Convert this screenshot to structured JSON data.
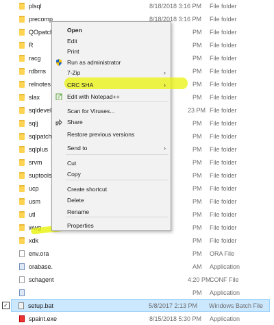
{
  "files": [
    {
      "name": "plsql",
      "date": "8/18/2018 3:16 PM",
      "type": "File folder",
      "icon": "folder"
    },
    {
      "name": "precomp",
      "date": "8/18/2018 3:16 PM",
      "type": "File folder",
      "icon": "folder"
    },
    {
      "name": "QOpatch",
      "date": "PM",
      "type": "File folder",
      "icon": "folder"
    },
    {
      "name": "R",
      "date": "PM",
      "type": "File folder",
      "icon": "folder"
    },
    {
      "name": "racg",
      "date": "PM",
      "type": "File folder",
      "icon": "folder"
    },
    {
      "name": "rdbms",
      "date": "PM",
      "type": "File folder",
      "icon": "folder"
    },
    {
      "name": "relnotes",
      "date": "PM",
      "type": "File folder",
      "icon": "folder"
    },
    {
      "name": "slax",
      "date": "PM",
      "type": "File folder",
      "icon": "folder"
    },
    {
      "name": "sqldevelo",
      "date": "23 PM",
      "type": "File folder",
      "icon": "folder"
    },
    {
      "name": "sqlj",
      "date": "PM",
      "type": "File folder",
      "icon": "folder"
    },
    {
      "name": "sqlpatch",
      "date": "PM",
      "type": "File folder",
      "icon": "folder"
    },
    {
      "name": "sqlplus",
      "date": "PM",
      "type": "File folder",
      "icon": "folder"
    },
    {
      "name": "srvm",
      "date": "PM",
      "type": "File folder",
      "icon": "folder"
    },
    {
      "name": "suptools",
      "date": "PM",
      "type": "File folder",
      "icon": "folder"
    },
    {
      "name": "ucp",
      "date": "PM",
      "type": "File folder",
      "icon": "folder"
    },
    {
      "name": "usm",
      "date": "PM",
      "type": "File folder",
      "icon": "folder"
    },
    {
      "name": "utl",
      "date": "PM",
      "type": "File folder",
      "icon": "folder"
    },
    {
      "name": "wwg",
      "date": "PM",
      "type": "File folder",
      "icon": "folder"
    },
    {
      "name": "xdk",
      "date": "PM",
      "type": "File folder",
      "icon": "folder"
    },
    {
      "name": "env.ora",
      "date": "PM",
      "type": "ORA File",
      "icon": "file"
    },
    {
      "name": "orabase.",
      "date": "AM",
      "type": "Application",
      "icon": "app"
    },
    {
      "name": "schagent",
      "date": "4:20 PM",
      "type": "CONF File",
      "icon": "file"
    },
    {
      "name": "",
      "date": "PM",
      "type": "Application",
      "icon": "app"
    },
    {
      "name": "setup.bat",
      "date": "5/8/2017 2:13 PM",
      "type": "Windows Batch File",
      "icon": "bat",
      "selected": true
    },
    {
      "name": "spaint.exe",
      "date": "8/15/2018 5:30 PM",
      "type": "Application",
      "icon": "red"
    }
  ],
  "menu": {
    "items": [
      {
        "label": "Open",
        "bold": true,
        "icon": ""
      },
      {
        "label": "Edit",
        "icon": ""
      },
      {
        "label": "Print",
        "icon": ""
      },
      {
        "label": "Run as administrator",
        "icon": "shield"
      },
      {
        "label": "7-Zip",
        "icon": "",
        "submenu": true
      },
      {
        "label": "CRC SHA",
        "icon": "",
        "submenu": true
      },
      {
        "label": "Edit with Notepad++",
        "icon": "notepad"
      },
      {
        "label": "Scan for Viruses...",
        "icon": ""
      },
      {
        "label": "Share",
        "icon": "share"
      },
      {
        "label": "Restore previous versions",
        "icon": ""
      },
      {
        "label": "Send to",
        "icon": "",
        "submenu": true
      },
      {
        "label": "Cut",
        "icon": ""
      },
      {
        "label": "Copy",
        "icon": ""
      },
      {
        "label": "Create shortcut",
        "icon": ""
      },
      {
        "label": "Delete",
        "icon": ""
      },
      {
        "label": "Rename",
        "icon": ""
      },
      {
        "label": "Properties",
        "icon": ""
      }
    ],
    "chevron": "›"
  },
  "colors": {
    "highlight": "#e9f30a",
    "selection": "#cce8ff"
  }
}
